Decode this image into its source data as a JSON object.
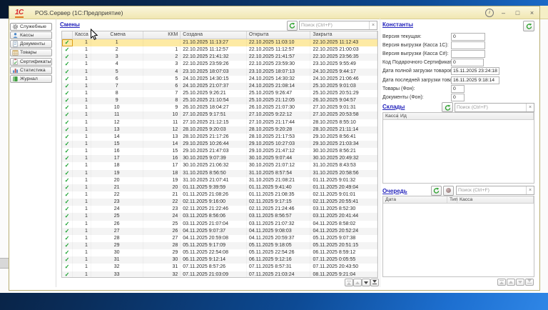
{
  "icons": {
    "check": "✓",
    "clear": "×"
  },
  "colors": {
    "titlebar": "#f5efc6",
    "selected_row": "#fdeaa4",
    "accent_green": "#2da12e",
    "link_blue": "#2121bb"
  },
  "window": {
    "logo": "1С",
    "title": "POS.Сервер  (1С:Предприятие)",
    "controls": [
      {
        "name": "info",
        "glyph": "i"
      },
      {
        "name": "minimize",
        "glyph": "–"
      },
      {
        "name": "maximize",
        "glyph": "□"
      },
      {
        "name": "close",
        "glyph": "×"
      }
    ]
  },
  "sidebar": {
    "items": [
      {
        "label": "Служебные",
        "icon": "gear-icon",
        "active": true
      },
      {
        "label": "Кассы",
        "icon": "cashbox-icon",
        "active": false
      },
      {
        "label": "Документы",
        "icon": "document-icon",
        "active": false
      },
      {
        "label": "Товары",
        "icon": "goods-icon",
        "active": false
      },
      {
        "label": "Сертификаты",
        "icon": "certificate-icon",
        "active": false
      },
      {
        "label": "Статистика",
        "icon": "statistics-icon",
        "active": false
      },
      {
        "label": "Журнал",
        "icon": "journal-icon",
        "active": false
      }
    ]
  },
  "shifts": {
    "title": "Смены",
    "search_placeholder": "Поиск (Ctrl+F)",
    "columns": [
      "Касса",
      "Смена",
      "ККМ",
      "Создана",
      "Открыта",
      "Закрыта"
    ],
    "selected_row": 0,
    "nav_buttons": [
      {
        "name": "go-first",
        "enabled": false
      },
      {
        "name": "go-previous",
        "enabled": false
      },
      {
        "name": "go-next",
        "enabled": true
      },
      {
        "name": "go-last",
        "enabled": true
      }
    ],
    "rows": [
      [
        "1",
        "1",
        "",
        "21.10.2025 11:13:27",
        "22.10.2025 11:03:10",
        "22.10.2025 11:12:43"
      ],
      [
        "1",
        "2",
        "1",
        "22.10.2025 11:12:57",
        "22.10.2025 11:12:57",
        "22.10.2025 21:00:03"
      ],
      [
        "1",
        "3",
        "2",
        "22.10.2025 21:41:32",
        "22.10.2025 21:41:57",
        "22.10.2025 23:56:35"
      ],
      [
        "1",
        "4",
        "3",
        "22.10.2025 23:59:26",
        "22.10.2025 23:59:30",
        "23.10.2025 9:55:49"
      ],
      [
        "1",
        "5",
        "4",
        "23.10.2025 18:07:03",
        "23.10.2025 18:07:13",
        "24.10.2025 9:44:17"
      ],
      [
        "1",
        "6",
        "5",
        "24.10.2025 14:30:15",
        "24.10.2025 14:30:32",
        "24.10.2025 21:06:46"
      ],
      [
        "1",
        "7",
        "6",
        "24.10.2025 21:07:37",
        "24.10.2025 21:08:14",
        "25.10.2025 9:01:03"
      ],
      [
        "1",
        "8",
        "7",
        "25.10.2025 9:26:21",
        "25.10.2025 9:26:47",
        "25.10.2025 20:51:29"
      ],
      [
        "1",
        "9",
        "8",
        "25.10.2025 21:10:54",
        "25.10.2025 21:12:05",
        "26.10.2025 9:04:57"
      ],
      [
        "1",
        "10",
        "9",
        "26.10.2025 18:04:27",
        "26.10.2025 21:07:30",
        "27.10.2025 9:01:31"
      ],
      [
        "1",
        "11",
        "10",
        "27.10.2025 9:17:51",
        "27.10.2025 9:22:12",
        "27.10.2025 20:53:58"
      ],
      [
        "1",
        "12",
        "11",
        "27.10.2025 21:12:15",
        "27.10.2025 21:17:44",
        "28.10.2025 8:55:10"
      ],
      [
        "1",
        "13",
        "12",
        "28.10.2025 9:20:03",
        "28.10.2025 9:20:28",
        "28.10.2025 21:11:14"
      ],
      [
        "1",
        "14",
        "13",
        "28.10.2025 21:17:26",
        "28.10.2025 21:17:53",
        "29.10.2025 8:56:41"
      ],
      [
        "1",
        "15",
        "14",
        "29.10.2025 10:26:44",
        "29.10.2025 10:27:03",
        "29.10.2025 21:03:34"
      ],
      [
        "1",
        "16",
        "15",
        "29.10.2025 21:47:03",
        "29.10.2025 21:47:12",
        "30.10.2025 8:56:21"
      ],
      [
        "1",
        "17",
        "16",
        "30.10.2025 9:07:39",
        "30.10.2025 9:07:44",
        "30.10.2025 20:49:32"
      ],
      [
        "1",
        "18",
        "17",
        "30.10.2025 21:06:32",
        "30.10.2025 21:07:12",
        "31.10.2025 8:43:53"
      ],
      [
        "1",
        "19",
        "18",
        "31.10.2025 8:56:50",
        "31.10.2025 8:57:54",
        "31.10.2025 20:58:56"
      ],
      [
        "1",
        "20",
        "19",
        "31.10.2025 21:07:41",
        "31.10.2025 21:08:21",
        "01.11.2025 9:01:32"
      ],
      [
        "1",
        "21",
        "20",
        "01.11.2025 9:39:59",
        "01.11.2025 9:41:40",
        "01.11.2025 20:49:04"
      ],
      [
        "1",
        "22",
        "21",
        "01.11.2025 21:08:26",
        "01.11.2025 21:08:35",
        "02.11.2025 9:01:01"
      ],
      [
        "1",
        "23",
        "22",
        "02.11.2025 9:16:00",
        "02.11.2025 9:17:15",
        "02.11.2025 20:55:41"
      ],
      [
        "1",
        "24",
        "23",
        "02.11.2025 21:22:46",
        "02.11.2025 21:24:46",
        "03.11.2025 8:52:30"
      ],
      [
        "1",
        "25",
        "24",
        "03.11.2025 8:56:06",
        "03.11.2025 8:56:57",
        "03.11.2025 20:41:44"
      ],
      [
        "1",
        "26",
        "25",
        "03.11.2025 21:07:04",
        "03.11.2025 21:07:32",
        "04.11.2025 8:58:02"
      ],
      [
        "1",
        "27",
        "26",
        "04.11.2025 9:07:37",
        "04.11.2025 9:08:03",
        "04.11.2025 20:52:24"
      ],
      [
        "1",
        "28",
        "27",
        "04.11.2025 20:59:08",
        "04.11.2025 20:59:37",
        "05.11.2025 9:07:38"
      ],
      [
        "1",
        "29",
        "28",
        "05.11.2025 9:17:09",
        "05.11.2025 9:18:05",
        "05.11.2025 20:51:15"
      ],
      [
        "1",
        "30",
        "29",
        "05.11.2025 22:54:08",
        "05.11.2025 22:54:26",
        "06.11.2025 8:59:12"
      ],
      [
        "1",
        "31",
        "30",
        "06.11.2025 9:12:14",
        "06.11.2025 9:12:16",
        "07.11.2025 0:05:55"
      ],
      [
        "1",
        "32",
        "31",
        "07.11.2025 8:57:26",
        "07.11.2025 8:57:31",
        "07.11.2025 20:43:50"
      ],
      [
        "1",
        "33",
        "32",
        "07.11.2025 21:03:09",
        "07.11.2025 21:03:24",
        "08.11.2025 9:21:04"
      ]
    ]
  },
  "constants": {
    "title": "Константы",
    "fields": [
      {
        "label": "Версия текущая:",
        "value": "0"
      },
      {
        "label": "Версия выгрузки (Касса 1С):",
        "value": ""
      },
      {
        "label": "Версия выгрузки (Касса С#):",
        "value": ""
      },
      {
        "label": "Код Подарочного Сертификата:",
        "value": "0"
      },
      {
        "label": "Дата полной загрузки товаров:",
        "value": "15.11.2025 23:24:18"
      },
      {
        "label": "Дата последней загрузки товаров:",
        "value": "16.11.2025 9:18:14"
      },
      {
        "label": "Товары (Фон):",
        "value": "0"
      },
      {
        "label": "Документы (Фон):",
        "value": "0"
      }
    ]
  },
  "warehouses": {
    "title": "Склады",
    "search_placeholder": "Поиск (Ctrl+F)",
    "columns": [
      "Касса",
      "Ид"
    ],
    "rows": []
  },
  "queue": {
    "title": "Очередь",
    "search_placeholder": "Поиск (Ctrl+F)",
    "columns": [
      "Дата",
      "Тип",
      "Касса"
    ],
    "rows": [],
    "nav_buttons": [
      {
        "name": "go-first",
        "enabled": false
      },
      {
        "name": "go-previous",
        "enabled": false
      },
      {
        "name": "go-next",
        "enabled": false
      },
      {
        "name": "go-last",
        "enabled": false
      }
    ]
  }
}
